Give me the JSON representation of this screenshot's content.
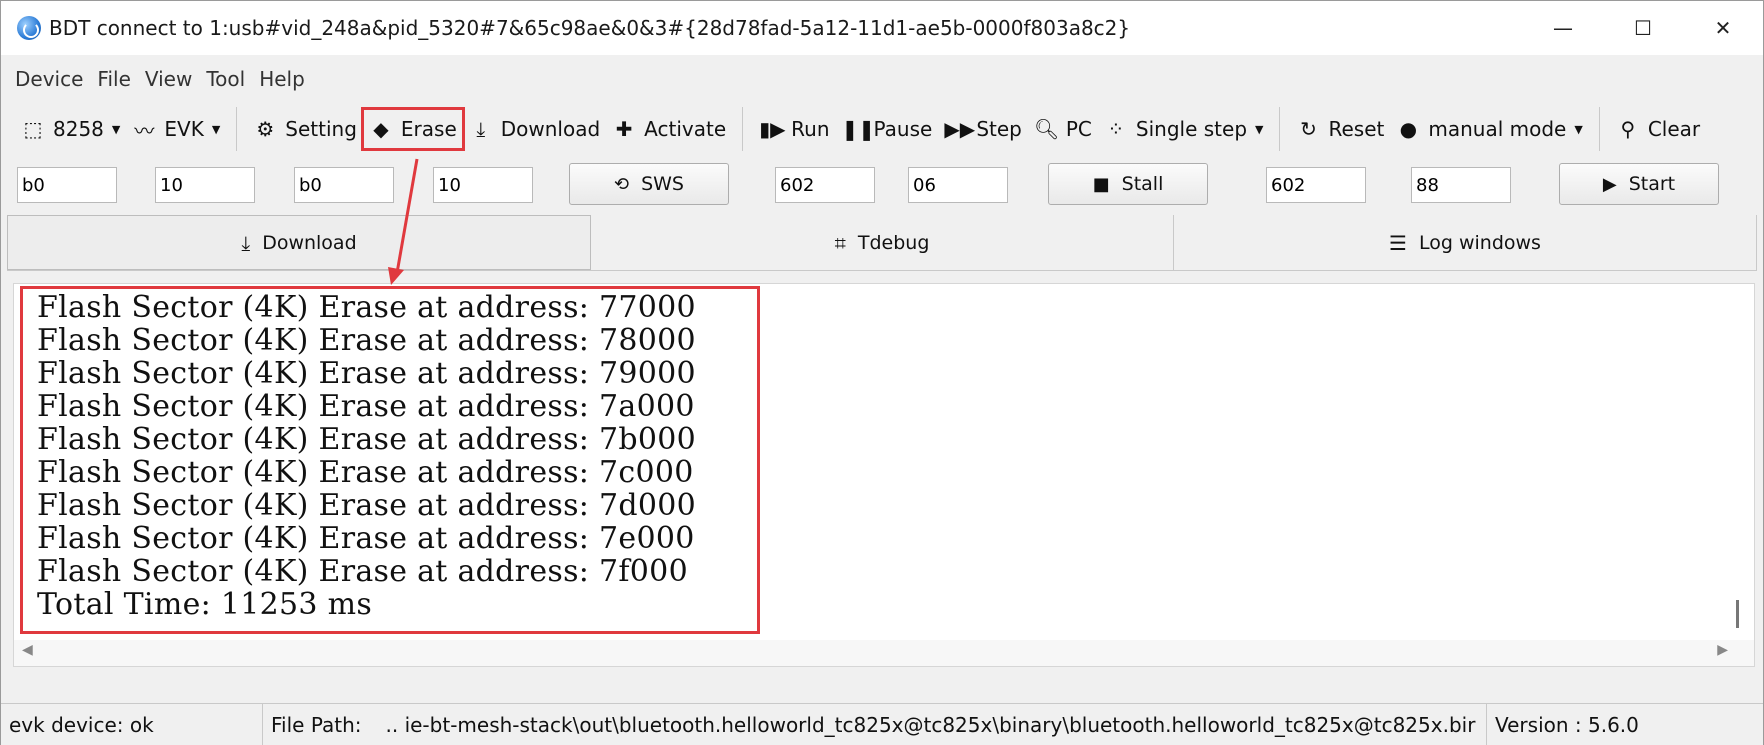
{
  "window": {
    "title": "BDT connect to 1:usb#vid_248a&pid_5320#7&65c98ae&0&3#{28d78fad-5a12-11d1-ae5b-0000f803a8c2}",
    "controls": {
      "minimize": "—",
      "maximize": "☐",
      "close": "✕"
    }
  },
  "menu": [
    "Device",
    "File",
    "View",
    "Tool",
    "Help"
  ],
  "toolbar": {
    "chip": "8258",
    "board": "EVK",
    "setting": "Setting",
    "erase": "Erase",
    "download": "Download",
    "activate": "Activate",
    "run": "Run",
    "pause": "Pause",
    "step": "Step",
    "pc": "PC",
    "single_step": "Single step",
    "reset": "Reset",
    "manual_mode": "manual mode",
    "clear": "Clear"
  },
  "inputs": {
    "f1": "b0",
    "f2": "10",
    "f3": "b0",
    "f4": "10",
    "sws_label": "SWS",
    "f5": "602",
    "f6": "06",
    "stall_label": "Stall",
    "f7": "602",
    "f8": "88",
    "start_label": "Start"
  },
  "tabs": [
    "Download",
    "Tdebug",
    "Log windows"
  ],
  "log": [
    "Flash Sector (4K) Erase at address: 77000",
    "Flash Sector (4K) Erase at address: 78000",
    "Flash Sector (4K) Erase at address: 79000",
    "Flash Sector (4K) Erase at address: 7a000",
    "Flash Sector (4K) Erase at address: 7b000",
    "Flash Sector (4K) Erase at address: 7c000",
    "Flash Sector (4K) Erase at address: 7d000",
    "Flash Sector (4K) Erase at address: 7e000",
    "Flash Sector (4K) Erase at address: 7f000",
    "Total Time: 11253 ms"
  ],
  "status": {
    "device": "evk device: ok",
    "file_path_label": "File Path:",
    "file_path": "..  ie-bt-mesh-stack\\out\\bluetooth.helloworld_tc825x@tc825x\\binary\\bluetooth.helloworld_tc825x@tc825x.bir",
    "version": "Version : 5.6.0"
  },
  "colors": {
    "highlight": "#e0393e"
  }
}
